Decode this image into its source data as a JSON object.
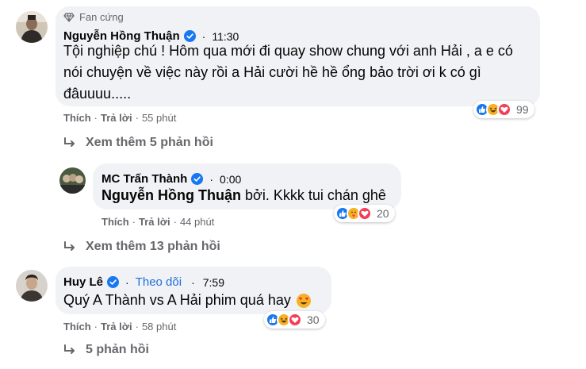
{
  "colors": {
    "bubble": "#f0f2f5",
    "text": "#050505",
    "muted": "#65676b",
    "verified": "#1877f2",
    "follow": "#216fdb",
    "like": "#1877f2",
    "love": "#f33e58",
    "haha": "#f7b125"
  },
  "comments": [
    {
      "badge": "Fan cứng",
      "badge_icon": "diamond-icon",
      "author": "Nguyễn Hồng Thuận",
      "verified": true,
      "time": "11:30",
      "text": "Tội nghiệp chú ! Hôm qua mới đi quay show chung với anh Hải , a e có nói chuyện về việc này rồi a Hải cười hề hề ổng bảo trời ơi k có gì đâuuuu.....",
      "actions": {
        "like": "Thích",
        "reply": "Trả lời",
        "ago": "55 phút"
      },
      "reactions": {
        "icons": [
          "like-icon",
          "haha-icon",
          "love-icon"
        ],
        "count": "99"
      },
      "more_replies": "Xem thêm 5 phản hồi"
    },
    {
      "author": "MC Trấn Thành",
      "verified": true,
      "time": "0:00",
      "mention": "Nguyễn Hồng Thuận",
      "text": "bởi. Kkkk tui chán ghê",
      "actions": {
        "like": "Thích",
        "reply": "Trả lời",
        "ago": "44 phút"
      },
      "reactions": {
        "icons": [
          "like-icon",
          "care-icon",
          "love-icon"
        ],
        "count": "20"
      },
      "more_replies": "Xem thêm 13 phản hồi"
    },
    {
      "author": "Huy Lê",
      "verified": true,
      "follow": "Theo dõi",
      "time": "7:59",
      "text": "Quý A Thành vs A Hải phim quá hay",
      "emoji_icon": "heart-eyes-emoji-icon",
      "actions": {
        "like": "Thích",
        "reply": "Trả lời",
        "ago": "58 phút"
      },
      "reactions": {
        "icons": [
          "like-icon",
          "haha-icon",
          "love-icon"
        ],
        "count": "30"
      },
      "more_replies": "5 phản hồi"
    }
  ]
}
